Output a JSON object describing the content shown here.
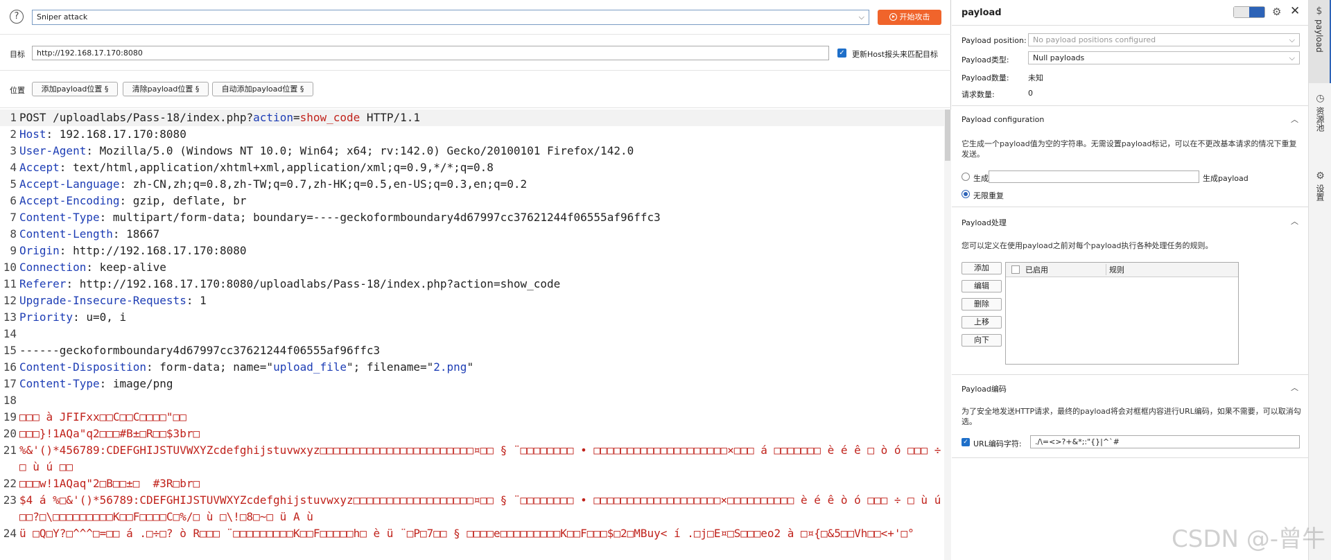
{
  "toolbar": {
    "attack_type": "Sniper attack",
    "start_label": "开始攻击"
  },
  "target": {
    "label": "目标",
    "value": "http://192.168.17.170:8080",
    "host_label": "更新Host报头来匹配目标"
  },
  "positions": {
    "label": "位置",
    "buttons": [
      "添加payload位置 §",
      "清除payload位置 §",
      "自动添加payload位置 §"
    ]
  },
  "editor": {
    "lines": [
      {
        "n": "1",
        "segs": [
          [
            "POST /uploadlabs/Pass-18/index.php?",
            ""
          ],
          [
            "action",
            "blue"
          ],
          [
            "=",
            ""
          ],
          [
            "show_code",
            "red"
          ],
          [
            " HTTP/1.1",
            ""
          ]
        ]
      },
      {
        "n": "2",
        "segs": [
          [
            "Host",
            "hname"
          ],
          [
            ": 192.168.17.170:8080",
            ""
          ]
        ]
      },
      {
        "n": "3",
        "segs": [
          [
            "User-Agent",
            "hname"
          ],
          [
            ": Mozilla/5.0 (Windows NT 10.0; Win64; x64; rv:142.0) Gecko/20100101 Firefox/142.0",
            ""
          ]
        ]
      },
      {
        "n": "4",
        "segs": [
          [
            "Accept",
            "hname"
          ],
          [
            ": text/html,application/xhtml+xml,application/xml;q=0.9,*/*;q=0.8",
            ""
          ]
        ]
      },
      {
        "n": "5",
        "segs": [
          [
            "Accept-Language",
            "hname"
          ],
          [
            ": zh-CN,zh;q=0.8,zh-TW;q=0.7,zh-HK;q=0.5,en-US;q=0.3,en;q=0.2",
            ""
          ]
        ]
      },
      {
        "n": "6",
        "segs": [
          [
            "Accept-Encoding",
            "hname"
          ],
          [
            ": gzip, deflate, br",
            ""
          ]
        ]
      },
      {
        "n": "7",
        "segs": [
          [
            "Content-Type",
            "hname"
          ],
          [
            ": multipart/form-data; boundary=----geckoformboundary4d67997cc37621244f06555af96ffc3",
            ""
          ]
        ]
      },
      {
        "n": "8",
        "segs": [
          [
            "Content-Length",
            "hname"
          ],
          [
            ": 18667",
            ""
          ]
        ]
      },
      {
        "n": "9",
        "segs": [
          [
            "Origin",
            "hname"
          ],
          [
            ": http://192.168.17.170:8080",
            ""
          ]
        ]
      },
      {
        "n": "10",
        "segs": [
          [
            "Connection",
            "hname"
          ],
          [
            ": keep-alive",
            ""
          ]
        ]
      },
      {
        "n": "11",
        "segs": [
          [
            "Referer",
            "hname"
          ],
          [
            ": http://192.168.17.170:8080/uploadlabs/Pass-18/index.php?action=show_code",
            ""
          ]
        ]
      },
      {
        "n": "12",
        "segs": [
          [
            "Upgrade-Insecure-Requests",
            "hname"
          ],
          [
            ": 1",
            ""
          ]
        ]
      },
      {
        "n": "13",
        "segs": [
          [
            "Priority",
            "hname"
          ],
          [
            ": u=0, i",
            ""
          ]
        ]
      },
      {
        "n": "14",
        "segs": [
          [
            "",
            ""
          ]
        ]
      },
      {
        "n": "15",
        "segs": [
          [
            "------geckoformboundary4d67997cc37621244f06555af96ffc3",
            ""
          ]
        ]
      },
      {
        "n": "16",
        "segs": [
          [
            "Content-Disposition",
            "hname"
          ],
          [
            ": form-data; name=\"",
            ""
          ],
          [
            "upload_file",
            "blue"
          ],
          [
            "\"; filename=\"",
            ""
          ],
          [
            "2.png",
            "blue"
          ],
          [
            "\"",
            ""
          ]
        ]
      },
      {
        "n": "17",
        "segs": [
          [
            "Content-Type",
            "hname"
          ],
          [
            ": image/png",
            ""
          ]
        ]
      },
      {
        "n": "18",
        "segs": [
          [
            "",
            ""
          ]
        ]
      },
      {
        "n": "19",
        "segs": [
          [
            "□□□ à JFIFxx□□C□□C□□□□\"□□",
            "bin"
          ]
        ]
      },
      {
        "n": "20",
        "segs": [
          [
            "□□□}!1AQa\"q2□□□#B±□R□□$3br□",
            "bin"
          ]
        ]
      },
      {
        "n": "21",
        "wrap": true,
        "segs": [
          [
            "%&'()*456789:CDEFGHIJSTUVWXYZcdefghijstuvwxyz□□□□□□□□□□□□□□□□□□□□□□□¤□□ § ¨□□□□□□□□ • □□□□□□□□□□□□□□□□□□□□×□□□ á □□□□□□□ è é ê □ ò ó □□□ ÷ □ ù ú □□",
            "bin"
          ]
        ]
      },
      {
        "n": "22",
        "segs": [
          [
            "□□□w!1AQaq\"2□B□□±□  #3R□br□",
            "bin"
          ]
        ]
      },
      {
        "n": "23",
        "wrap": true,
        "segs": [
          [
            "$4 á %□&'()*56789:CDEFGHIJSTUVWXYZcdefghijstuvwxyz□□□□□□□□□□□□□□□□□□¤□□ § ¨□□□□□□□□ • □□□□□□□□□□□□□□□□□□□×□□□□□□□□□□ è é ê ò ó □□□ ÷ □ ù ú □□?□\\□□□□□□□□□K□□F□□□□C□%/□ ù □\\!□8□~□ ü A ù",
            "bin"
          ]
        ]
      },
      {
        "n": "24",
        "wrap": true,
        "segs": [
          [
            "ü □Q□Y?□^^^□=□□ á .□÷□? ò R□□□ ¨□□□□□□□□□K□□F□□□□□h□ è ü ¨□P□7□□ § □□□□e□□□□□□□□□K□□F□□□$□2□MBuy< í .□j□E¤□S□□□eo2 à □¤{□&5□□Vh□□<+'□°",
            "bin"
          ]
        ]
      }
    ]
  },
  "payload_panel": {
    "title": "payload",
    "position_label": "Payload position:",
    "position_value": "No payload positions configured",
    "type_label": "Payload类型:",
    "type_value": "Null payloads",
    "count_label": "Payload数量:",
    "count_value": "未知",
    "req_label": "请求数量:",
    "req_value": "0",
    "config_title": "Payload configuration",
    "config_desc": "它生成一个payload值为空的字符串。无需设置payload标记，可以在不更改基本请求的情况下重复发送。",
    "gen_label": "生成",
    "gen_suffix": "生成payload",
    "infinite_label": "无限重复",
    "proc_title": "Payload处理",
    "proc_desc": "您可以定义在使用payload之前对每个payload执行各种处理任务的规则。",
    "proc_buttons": [
      "添加",
      "编辑",
      "删除",
      "上移",
      "向下"
    ],
    "col_enabled": "已启用",
    "col_rule": "规则",
    "enc_title": "Payload编码",
    "enc_desc": "为了安全地发送HTTP请求，最终的payload将会对框框内容进行URL编码，如果不需要，可以取消勾选。",
    "enc_label": "URL编码字符:",
    "enc_value": "./\\=<>?+&*;:\"{}|^`#"
  },
  "sidebar": {
    "tabs": [
      "payload",
      "资源池",
      "设置"
    ]
  },
  "watermark": "CSDN @-曾牛"
}
